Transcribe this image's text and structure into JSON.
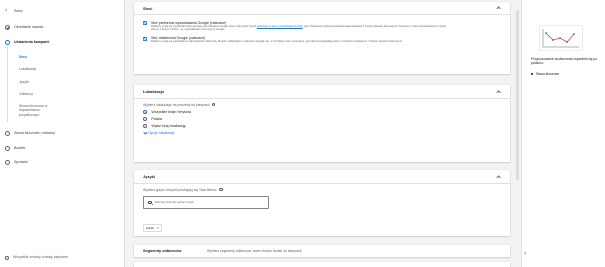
{
  "nav": {
    "items": [
      {
        "label": "Szkic",
        "state": "done"
      },
      {
        "label": "Określanie stawek",
        "state": "done"
      },
      {
        "label": "Ustawienia kampanii",
        "state": "active"
      }
    ],
    "subitems": [
      "Sieci",
      "Lokalizacje",
      "Języki",
      "Odbiorcy",
      "Słowa kluczowe w dopasowaniu przybliżonym"
    ],
    "current_subitem": "Sieci",
    "more_items": [
      "Słowa kluczowe i reklamy",
      "Budżet",
      "Sprawdź"
    ],
    "footer": "Wszystkie zmiany zostały zapisane"
  },
  "networks": {
    "title": "Sieci",
    "search_partners": {
      "title": "Sieć partnerów wyszukiwania Google (zalecane)",
      "desc_before": "Reklamy mogą się wyświetlać obok wyników wyszukiwania Google oraz w witrynach innych ",
      "desc_link": "partnerów w sieci wyszukiwania Google",
      "desc_after": ", gdy użytkownicy będą wyszukiwać hasła związane z Twoimi słowami kluczowymi. Partnerzy w sieci wyszukiwania to często witryny z dużym ruchem, np. wyszukiwarki i inne witryny Google"
    },
    "display": {
      "title": "Sieć reklamowa Google (zalecane)",
      "desc": "Reklamy mogą się wyświetlać w odpowiednich witrynach, filmach i aplikacjach w całej sieci Google (np. w YouTube) oraz w internecie, gdy klienci przeglądają strony z treściami związanymi z Twoimi słowami kluczowymi."
    }
  },
  "locations": {
    "title": "Lokalizacje",
    "prompt": "Wybierz lokalizacje na potrzeby tej kampanii",
    "options": [
      "Wszystkie kraje i terytoria",
      "Polska",
      "Wpisz inną lokalizację"
    ],
    "selected_index": 0,
    "more_link": "Opcje lokalizacji"
  },
  "languages": {
    "title": "Języki",
    "prompt": "Wybierz języki, którymi posługują się Twoi klienci.",
    "search_placeholder": "Zacznij pisać lub wybierz język",
    "chip": "polski"
  },
  "segments": {
    "title": "Segmenty odbiorców",
    "desc": "Wybierz segmenty odbiorców, które chcesz dodać do kampanii."
  },
  "right_panel": {
    "title": "Prognozowanie skuteczności wyświetli się po podaniu:",
    "bullet": "Słowa kluczowe"
  },
  "colors": {
    "accent": "#1a73e8",
    "chart_line": "#ea4335",
    "chart_points": "#1a73e8"
  }
}
